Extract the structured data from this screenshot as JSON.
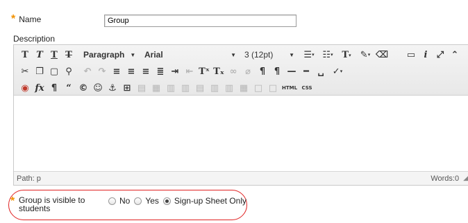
{
  "form": {
    "name_label": "Name",
    "name_value": "Group",
    "description_label": "Description",
    "required_marker": "*"
  },
  "toolbar": {
    "row1": {
      "format_buttons": [
        "T",
        "T",
        "T",
        "T"
      ],
      "paragraph_select": "Paragraph",
      "font_select": "Arial",
      "size_select": "3 (12pt)"
    },
    "row3_text_buttons": {
      "html": "HTML",
      "css": "CSS"
    }
  },
  "status": {
    "path_label": "Path: p",
    "words_label": "Words:0"
  },
  "visibility": {
    "label": "Group is visible to students",
    "options": [
      {
        "label": "No",
        "selected": false
      },
      {
        "label": "Yes",
        "selected": false
      },
      {
        "label": "Sign-up Sheet Only",
        "selected": true
      }
    ]
  },
  "colors": {
    "required": "#f29100",
    "highlight_oval": "#e02020"
  },
  "icons": [
    "bold-icon",
    "italic-icon",
    "underline-icon",
    "strikethrough-icon",
    "cut-icon",
    "copy-icon",
    "paste-icon",
    "find-icon",
    "undo-icon",
    "redo-icon",
    "align-left-icon",
    "align-center-icon",
    "align-right-icon",
    "justify-icon",
    "indent-icon",
    "outdent-icon",
    "superscript-icon",
    "subscript-icon",
    "link-icon",
    "unlink-icon",
    "ltr-icon",
    "rtl-icon",
    "hr-icon",
    "nonbreaking-space-icon",
    "spellcheck-icon",
    "record-icon",
    "formula-icon",
    "paragraph-mark-icon",
    "blockquote-icon",
    "copyright-icon",
    "emoticon-icon",
    "anchor-icon",
    "table-icon",
    "preview-icon",
    "info-icon",
    "fullscreen-icon",
    "collapse-icon"
  ]
}
